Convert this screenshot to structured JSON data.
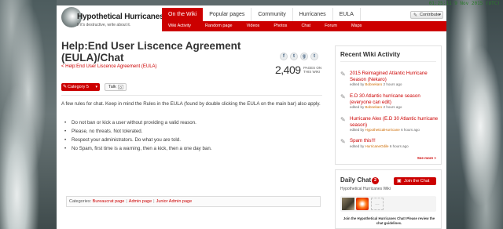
{
  "clock": {
    "time": "01:25:11 9 Nov 2015 (UTC)"
  },
  "wordmark": {
    "title": "Hypothetical Hurricanes",
    "tagline": "If it's destructive, write about it."
  },
  "header": {
    "contribute_label": "Contribute",
    "tabs": [
      {
        "label": "On the Wiki",
        "active": true
      },
      {
        "label": "Popular pages",
        "active": false
      },
      {
        "label": "Community",
        "active": false
      },
      {
        "label": "Hurricanes",
        "active": false
      },
      {
        "label": "EULA",
        "active": false
      }
    ],
    "subnav": [
      "Wiki Activity",
      "Random page",
      "Videos",
      "Photos",
      "Chat",
      "Forum",
      "Maps"
    ]
  },
  "article": {
    "title": "Help:End User Liscence Agreement (EULA)/Chat",
    "breadcrumb": "< Help:End User Liscence Agreement (EULA)",
    "page_count": "2,409",
    "page_count_label": "PAGES ON THIS WIKI",
    "category_button": "Category 5",
    "talk_button": "Talk",
    "talk_count": "0",
    "intro": "A few rules for chat. Keep in mind the Rules in the EULA (found by double clicking the EULA on the main bar) also apply.",
    "rules": [
      "Do not ban or kick a user without providing a valid reason.",
      "Please, no threats. Not tolerated.",
      "Respect your administrators. Do what you are told.",
      "No Spam, first time is a warning, then a kick, then a one day ban."
    ],
    "categories_label": "Categories:",
    "categories": [
      "Bureaucrat page",
      "Admin page",
      "Junior Admin page"
    ]
  },
  "social": [
    "f",
    "t",
    "g",
    "t"
  ],
  "recent_activity": {
    "title": "Recent Wiki Activity",
    "items": [
      {
        "link": "2015 Reimagined Atlantic Hurricane Season (Nekaro)",
        "prefix": "edited by",
        "user": "Bobnekaro",
        "time": "2 hours ago"
      },
      {
        "link": "E.D 30 Atlantic hurricane season (everyone can edit)",
        "prefix": "edited by",
        "user": "Bobnekaro",
        "time": "2 hours ago"
      },
      {
        "link": "Hurricane Alex (E.D 30 Atlantic hurricane season)",
        "prefix": "edited by",
        "user": "HypotheticalHurricane",
        "time": "6 hours ago"
      },
      {
        "link": "Spam this!!!",
        "prefix": "edited by",
        "user": "HurricaneOdile",
        "time": "6 hours ago"
      }
    ],
    "see_more": "See more >"
  },
  "daily_chat": {
    "title": "Daily Chat",
    "badge": "2",
    "join_label": "Join the Chat",
    "wiki_name": "Hypothetical Hurricanes Wiki",
    "note": "Join the Hypothetical Hurricanes Chat! Please review the chat guidelines."
  },
  "colors": {
    "accent": "#cc0000",
    "user_link": "#cc6a00"
  }
}
